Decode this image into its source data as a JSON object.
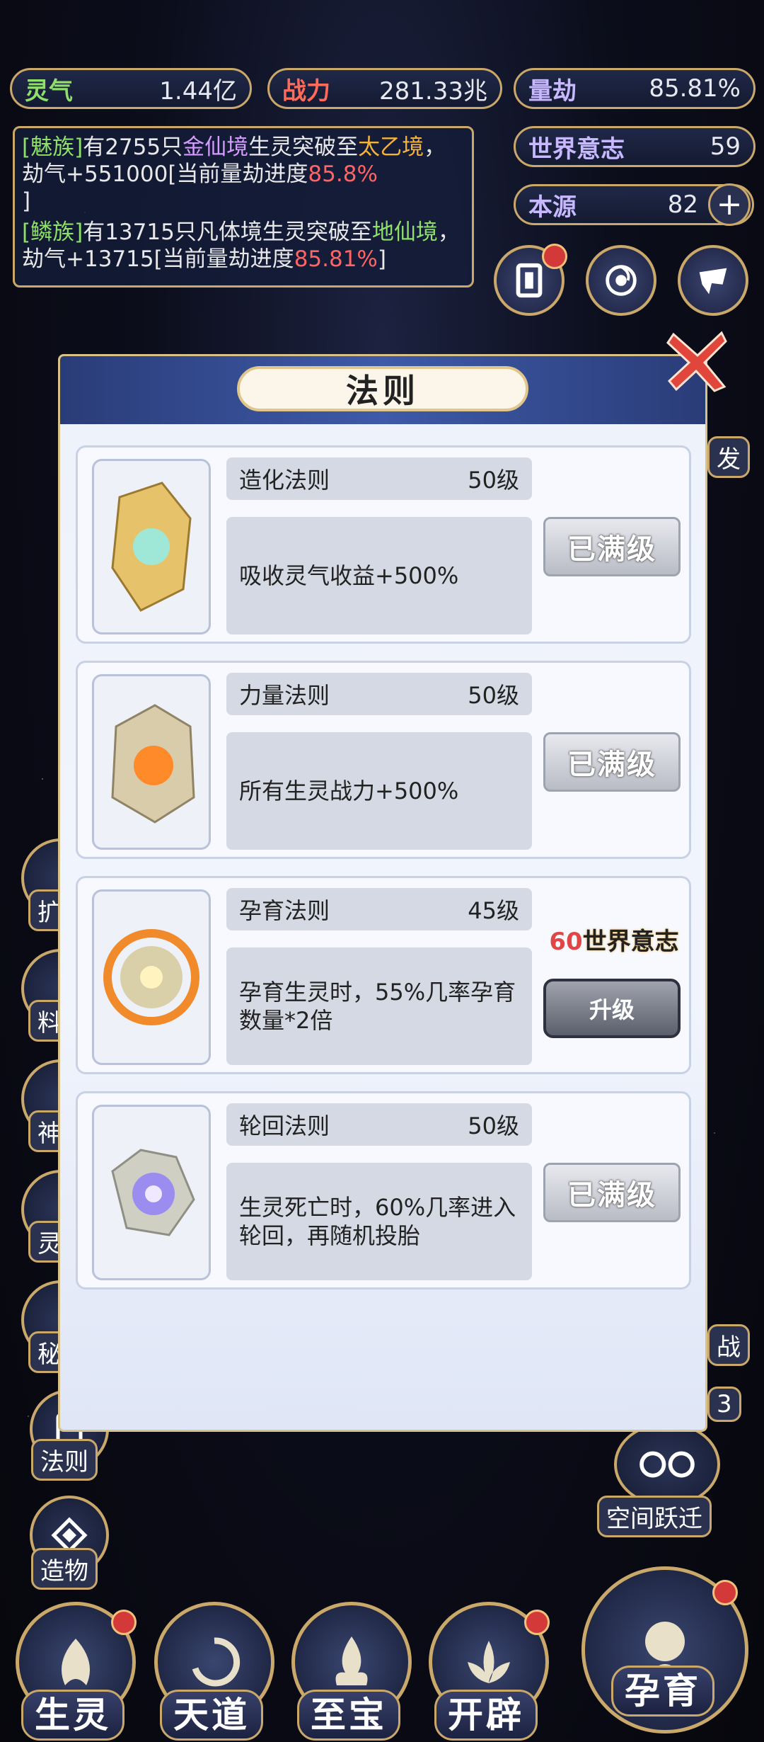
{
  "stats": {
    "lingqi": {
      "label": "灵气",
      "value": "1.44亿"
    },
    "zhanli": {
      "label": "战力",
      "value": "281.33兆"
    },
    "liangjie": {
      "label": "量劫",
      "value": "85.81%"
    },
    "shijie": {
      "label": "世界意志",
      "value": "59"
    },
    "benyuan": {
      "label": "本源",
      "value": "82"
    }
  },
  "log": [
    {
      "tribe": "[魅族]",
      "pre": "有2755只",
      "from": "金仙境",
      "mid": "生灵突破至",
      "to": "太乙境",
      "post": "，劫气+551000[当前量劫进度",
      "pct": "85.8%",
      "end": "]"
    },
    {
      "tribe": "[鳞族]",
      "pre": "有13715只凡体境生灵突破至",
      "to": "地仙境",
      "post": "，劫气+13715[当前量劫进度",
      "pct": "85.81%",
      "end": "]"
    }
  ],
  "dialog": {
    "title": "法则",
    "laws": [
      {
        "name": "造化法则",
        "level": "50级",
        "desc": "吸收灵气收益+500%",
        "button": "已满级"
      },
      {
        "name": "力量法则",
        "level": "50级",
        "desc": "所有生灵战力+500%",
        "button": "已满级"
      },
      {
        "name": "孕育法则",
        "level": "45级",
        "desc": "孕育生灵时，55%几率孕育数量*2倍",
        "cost_num": "60",
        "cost_unit": "世界意志",
        "button": "升级"
      },
      {
        "name": "轮回法则",
        "level": "50级",
        "desc": "生灵死亡时，60%几率进入轮回，再随机投胎",
        "button": "已满级"
      }
    ]
  },
  "side_menu": {
    "faze": "法则",
    "zaowu": "造物",
    "kongjian": "空间跃迁"
  },
  "side_partial": {
    "left1": "扩",
    "left2": "料",
    "left3": "神",
    "left4": "灵",
    "left5": "秘",
    "right1": "发",
    "right2": "战",
    "right3": "3"
  },
  "bottom_nav": [
    "生灵",
    "天道",
    "至宝",
    "开辟",
    "孕育"
  ]
}
